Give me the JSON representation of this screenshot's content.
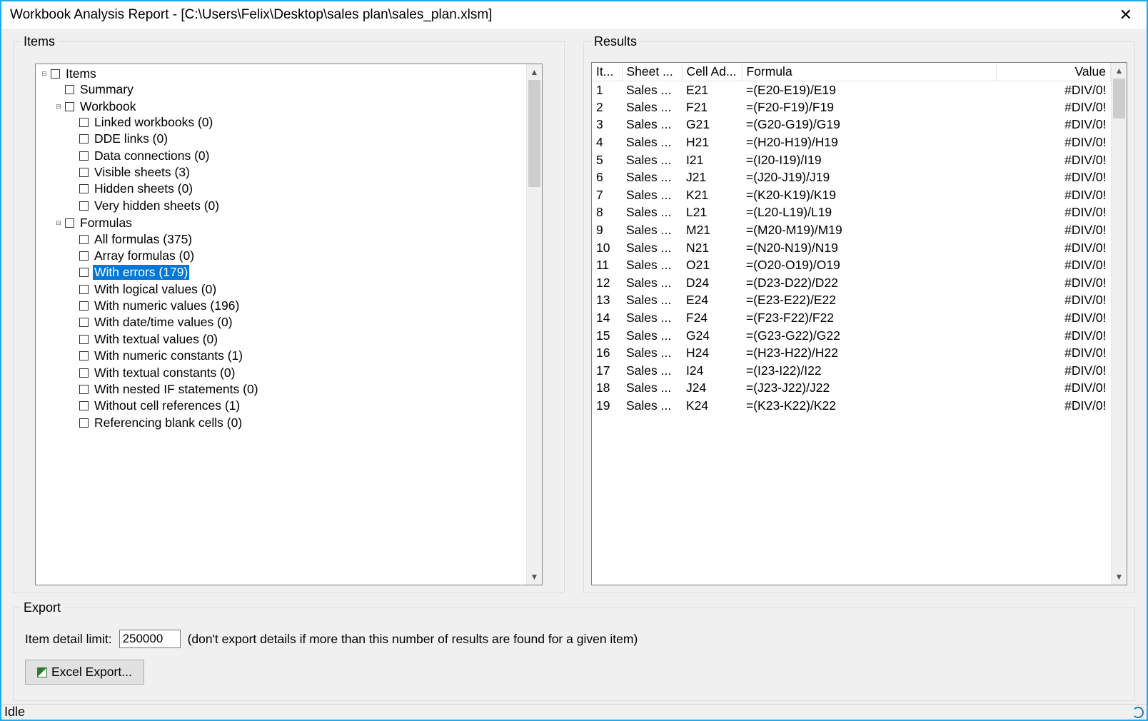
{
  "window": {
    "title": "Workbook Analysis Report - [C:\\Users\\Felix\\Desktop\\sales plan\\sales_plan.xlsm]"
  },
  "items_group": {
    "legend": "Items"
  },
  "tree": {
    "root": "Items",
    "summary": "Summary",
    "workbook": "Workbook",
    "workbook_children": [
      "Linked workbooks (0)",
      "DDE links (0)",
      "Data connections (0)",
      "Visible sheets (3)",
      "Hidden sheets (0)",
      "Very hidden sheets (0)"
    ],
    "formulas": "Formulas",
    "formulas_children": [
      "All formulas (375)",
      "Array formulas (0)",
      "With errors (179)",
      "With logical values (0)",
      "With numeric values (196)",
      "With date/time values (0)",
      "With textual values (0)",
      "With numeric constants (1)",
      "With textual constants (0)",
      "With nested IF statements (0)",
      "Without cell references (1)",
      "Referencing blank cells (0)"
    ],
    "selected_index": 2
  },
  "results_group": {
    "legend": "Results"
  },
  "results": {
    "columns": {
      "c0": "It...",
      "c1": "Sheet ...",
      "c2": "Cell Ad...",
      "c3": "Formula",
      "c4": "Value"
    },
    "rows": [
      {
        "n": "1",
        "sheet": "Sales ...",
        "cell": "E21",
        "formula": "=(E20-E19)/E19",
        "value": "#DIV/0!"
      },
      {
        "n": "2",
        "sheet": "Sales ...",
        "cell": "F21",
        "formula": "=(F20-F19)/F19",
        "value": "#DIV/0!"
      },
      {
        "n": "3",
        "sheet": "Sales ...",
        "cell": "G21",
        "formula": "=(G20-G19)/G19",
        "value": "#DIV/0!"
      },
      {
        "n": "4",
        "sheet": "Sales ...",
        "cell": "H21",
        "formula": "=(H20-H19)/H19",
        "value": "#DIV/0!"
      },
      {
        "n": "5",
        "sheet": "Sales ...",
        "cell": "I21",
        "formula": "=(I20-I19)/I19",
        "value": "#DIV/0!"
      },
      {
        "n": "6",
        "sheet": "Sales ...",
        "cell": "J21",
        "formula": "=(J20-J19)/J19",
        "value": "#DIV/0!"
      },
      {
        "n": "7",
        "sheet": "Sales ...",
        "cell": "K21",
        "formula": "=(K20-K19)/K19",
        "value": "#DIV/0!"
      },
      {
        "n": "8",
        "sheet": "Sales ...",
        "cell": "L21",
        "formula": "=(L20-L19)/L19",
        "value": "#DIV/0!"
      },
      {
        "n": "9",
        "sheet": "Sales ...",
        "cell": "M21",
        "formula": "=(M20-M19)/M19",
        "value": "#DIV/0!"
      },
      {
        "n": "10",
        "sheet": "Sales ...",
        "cell": "N21",
        "formula": "=(N20-N19)/N19",
        "value": "#DIV/0!"
      },
      {
        "n": "11",
        "sheet": "Sales ...",
        "cell": "O21",
        "formula": "=(O20-O19)/O19",
        "value": "#DIV/0!"
      },
      {
        "n": "12",
        "sheet": "Sales ...",
        "cell": "D24",
        "formula": "=(D23-D22)/D22",
        "value": "#DIV/0!"
      },
      {
        "n": "13",
        "sheet": "Sales ...",
        "cell": "E24",
        "formula": "=(E23-E22)/E22",
        "value": "#DIV/0!"
      },
      {
        "n": "14",
        "sheet": "Sales ...",
        "cell": "F24",
        "formula": "=(F23-F22)/F22",
        "value": "#DIV/0!"
      },
      {
        "n": "15",
        "sheet": "Sales ...",
        "cell": "G24",
        "formula": "=(G23-G22)/G22",
        "value": "#DIV/0!"
      },
      {
        "n": "16",
        "sheet": "Sales ...",
        "cell": "H24",
        "formula": "=(H23-H22)/H22",
        "value": "#DIV/0!"
      },
      {
        "n": "17",
        "sheet": "Sales ...",
        "cell": "I24",
        "formula": "=(I23-I22)/I22",
        "value": "#DIV/0!"
      },
      {
        "n": "18",
        "sheet": "Sales ...",
        "cell": "J24",
        "formula": "=(J23-J22)/J22",
        "value": "#DIV/0!"
      },
      {
        "n": "19",
        "sheet": "Sales ...",
        "cell": "K24",
        "formula": "=(K23-K22)/K22",
        "value": "#DIV/0!"
      }
    ]
  },
  "export": {
    "legend": "Export",
    "limit_label": "Item detail limit:",
    "limit_value": "250000",
    "limit_hint": "(don't export details if more than this number of results are found for a given item)",
    "button": "Excel Export..."
  },
  "status": {
    "text": "Idle"
  }
}
